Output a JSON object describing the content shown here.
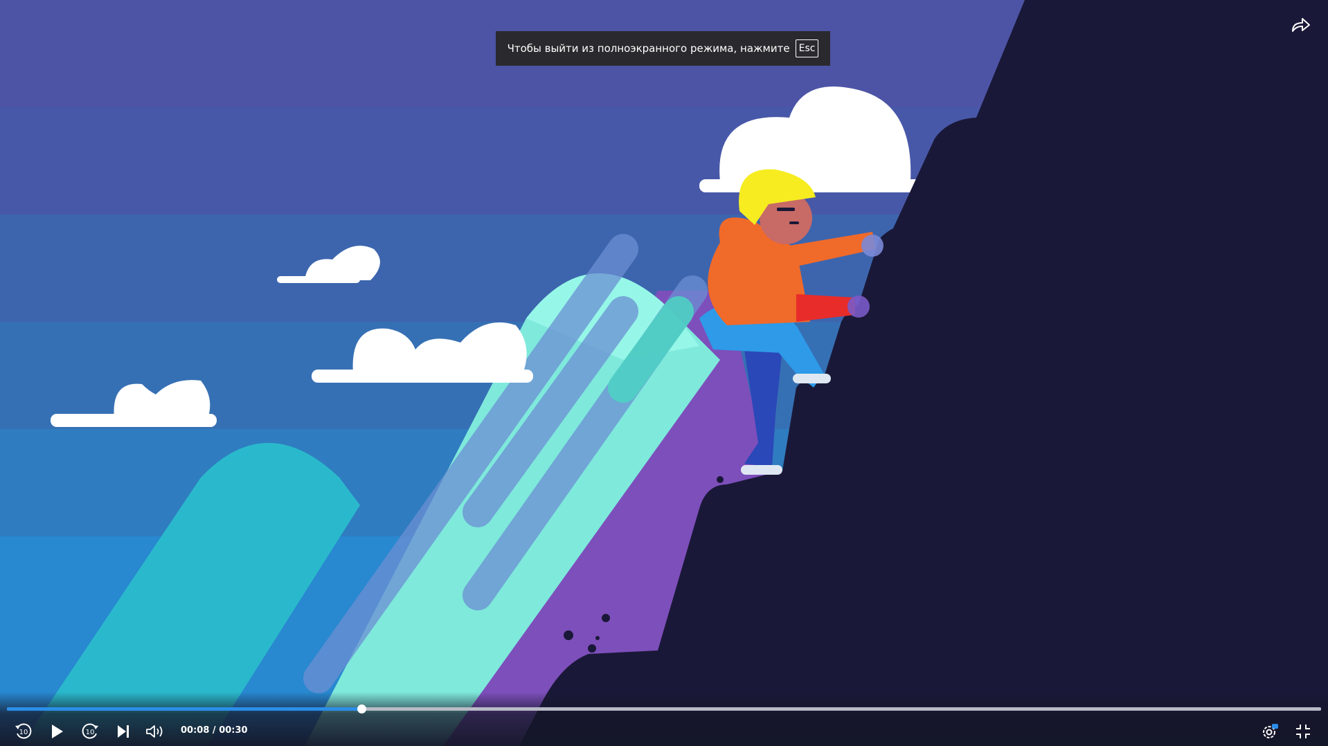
{
  "notification": {
    "text": "Чтобы выйти из полноэкранного режима, нажмите",
    "key_label": "Esc"
  },
  "player": {
    "current_time": "00:08",
    "separator": "/",
    "duration": "00:30",
    "progress_fraction": 0.27
  },
  "icons": {
    "share": "share-icon",
    "rewind": "rewind-10-icon",
    "play": "play-icon",
    "forward": "forward-10-icon",
    "next": "skip-next-icon",
    "volume": "volume-icon",
    "settings": "settings-gear-icon",
    "exit_fullscreen": "exit-fullscreen-icon"
  },
  "rewind_label": "10",
  "forward_label": "10",
  "colors": {
    "accent": "#2b8ee8",
    "mountain": "#1a1838",
    "toast_bg": "#2a2a2e"
  }
}
